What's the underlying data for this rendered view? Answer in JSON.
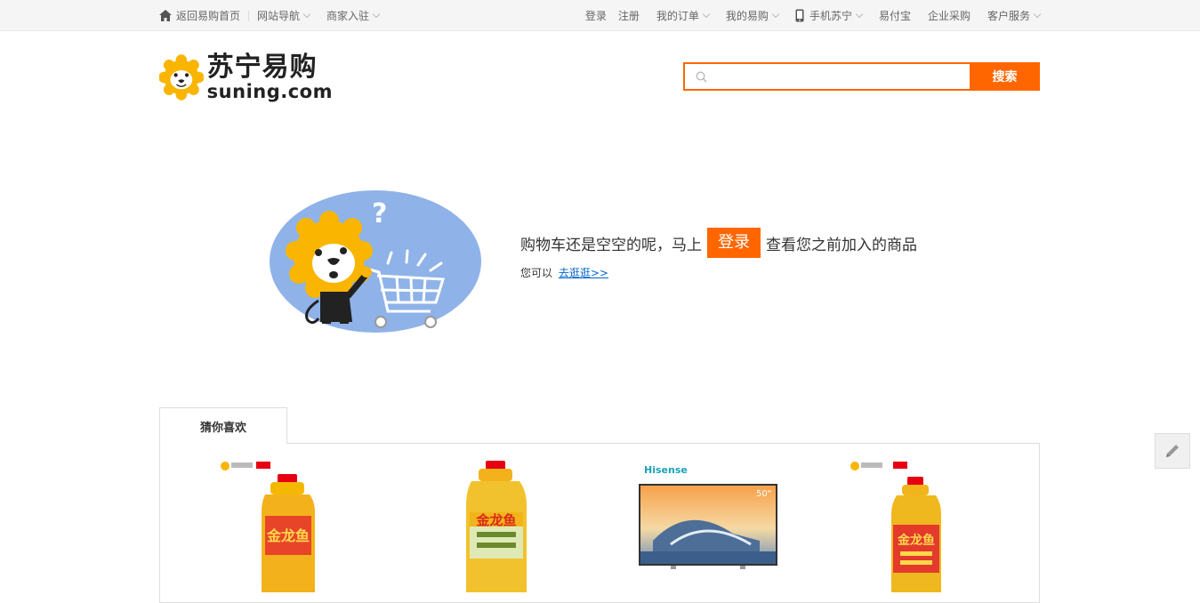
{
  "topbar": {
    "left": {
      "home": "返回易购首页",
      "site_nav": "网站导航",
      "merchant": "商家入驻"
    },
    "right": {
      "login": "登录",
      "register": "注册",
      "my_orders": "我的订单",
      "my_yigou": "我的易购",
      "mobile": "手机苏宁",
      "yifubao": "易付宝",
      "enterprise": "企业采购",
      "service": "客户服务"
    }
  },
  "header": {
    "logo_cn": "苏宁易购",
    "logo_en": "suning.com",
    "search_placeholder": "",
    "search_button": "搜索"
  },
  "empty_cart": {
    "text_before": "购物车还是空空的呢，马上",
    "login_button": "登录",
    "text_after": "查看您之前加入的商品",
    "sub_prefix": "您可以",
    "sub_link": "去逛逛>>"
  },
  "recommend": {
    "tab_label": "猜你喜欢",
    "products": [
      {
        "brand": "金龙鱼",
        "kind": "oil-bottle"
      },
      {
        "brand": "金龙鱼",
        "kind": "oil-bottle"
      },
      {
        "brand": "Hisense",
        "badge": "50\"",
        "kind": "tv"
      },
      {
        "brand": "金龙鱼",
        "kind": "oil-bottle"
      }
    ]
  },
  "colors": {
    "accent": "#ff6600",
    "link": "#0066cc",
    "mascot": "#f9b500"
  }
}
